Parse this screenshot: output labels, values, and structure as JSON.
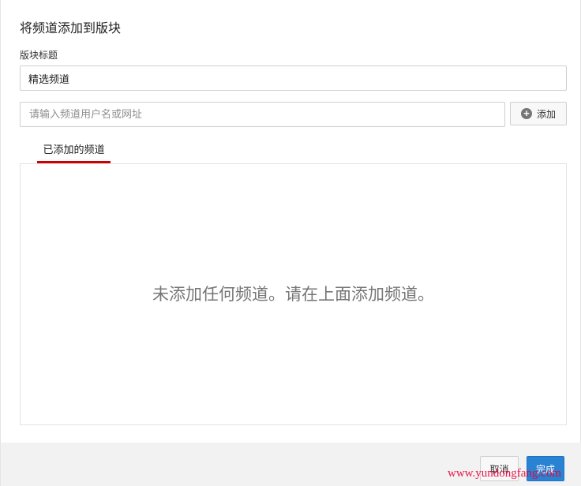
{
  "dialog": {
    "title": "将频道添加到版块"
  },
  "section_title": {
    "label": "版块标题",
    "value": "精选频道"
  },
  "channel_search": {
    "placeholder": "请输入频道用户名或网址",
    "add_button_label": "添加",
    "add_icon": "plus-circle-icon"
  },
  "tabs": [
    {
      "label": "已添加的频道",
      "active": true
    }
  ],
  "channel_list": {
    "empty_message": "未添加任何频道。请在上面添加频道。"
  },
  "footer": {
    "cancel_label": "取消",
    "done_label": "完成"
  },
  "watermark": {
    "text": "www.yundongfang.com"
  },
  "colors": {
    "tab_underline": "#cc0000",
    "primary_button": "#2a82d2",
    "watermark": "#e8003a"
  }
}
